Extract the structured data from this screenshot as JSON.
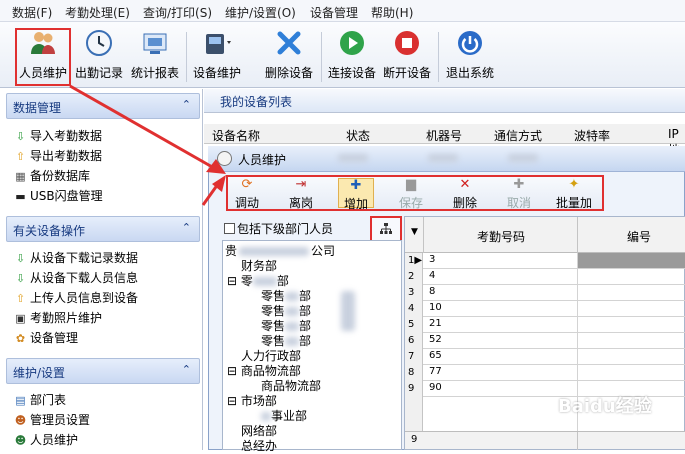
{
  "menu": [
    "数据(F)",
    "考勤处理(E)",
    "查询/打印(S)",
    "维护/设置(O)",
    "设备管理",
    "帮助(H)"
  ],
  "toolbar": {
    "staff": "人员维护",
    "attendance": "出勤记录",
    "stats": "统计报表",
    "device_maint": "设备维护",
    "delete_device": "删除设备",
    "connect": "连接设备",
    "disconnect": "断开设备",
    "exit": "退出系统"
  },
  "sidebar": {
    "data_mgmt": {
      "title": "数据管理",
      "items": [
        "导入考勤数据",
        "导出考勤数据",
        "备份数据库",
        "USB闪盘管理"
      ]
    },
    "device_ops": {
      "title": "有关设备操作",
      "items": [
        "从设备下载记录数据",
        "从设备下载人员信息",
        "上传人员信息到设备",
        "考勤照片维护",
        "设备管理"
      ]
    },
    "maint": {
      "title": "维护/设置",
      "items": [
        "部门表",
        "管理员设置",
        "人员维护"
      ]
    }
  },
  "device_list": {
    "title": "我的设备列表",
    "columns": [
      "设备名称",
      "状态",
      "机器号",
      "通信方式",
      "波特率",
      "IP地"
    ]
  },
  "dialog": {
    "title": "人员维护",
    "buttons": {
      "transfer": "调动",
      "leave": "离岗",
      "add": "增加",
      "save": "保存",
      "delete": "删除",
      "cancel": "取消",
      "batch_add": "批量加"
    },
    "include_sub": "包括下级部门人员",
    "tree": {
      "root": "贵",
      "root_suffix": "公司",
      "finance": "财务部",
      "zero": "零",
      "zero_suffix": "部",
      "z1": "零售",
      "z2": "零售",
      "z3": "零售",
      "z4": "零售",
      "z_suffix": "部",
      "hr": "人力行政部",
      "logistics": "商品物流部",
      "logistics_sub": "商品物流部",
      "market": "市场部",
      "market_sub": "事业部",
      "network": "网络部",
      "ceo": "总经办"
    },
    "grid": {
      "col_id": "考勤号码",
      "col_code": "编号",
      "rows": [
        "3",
        "4",
        "8",
        "10",
        "21",
        "52",
        "65",
        "77",
        "90"
      ],
      "row_numbers": [
        "1",
        "2",
        "3",
        "4",
        "5",
        "6",
        "7",
        "8",
        "9"
      ],
      "footer_row": "9"
    }
  },
  "watermark": "Baidu经验"
}
